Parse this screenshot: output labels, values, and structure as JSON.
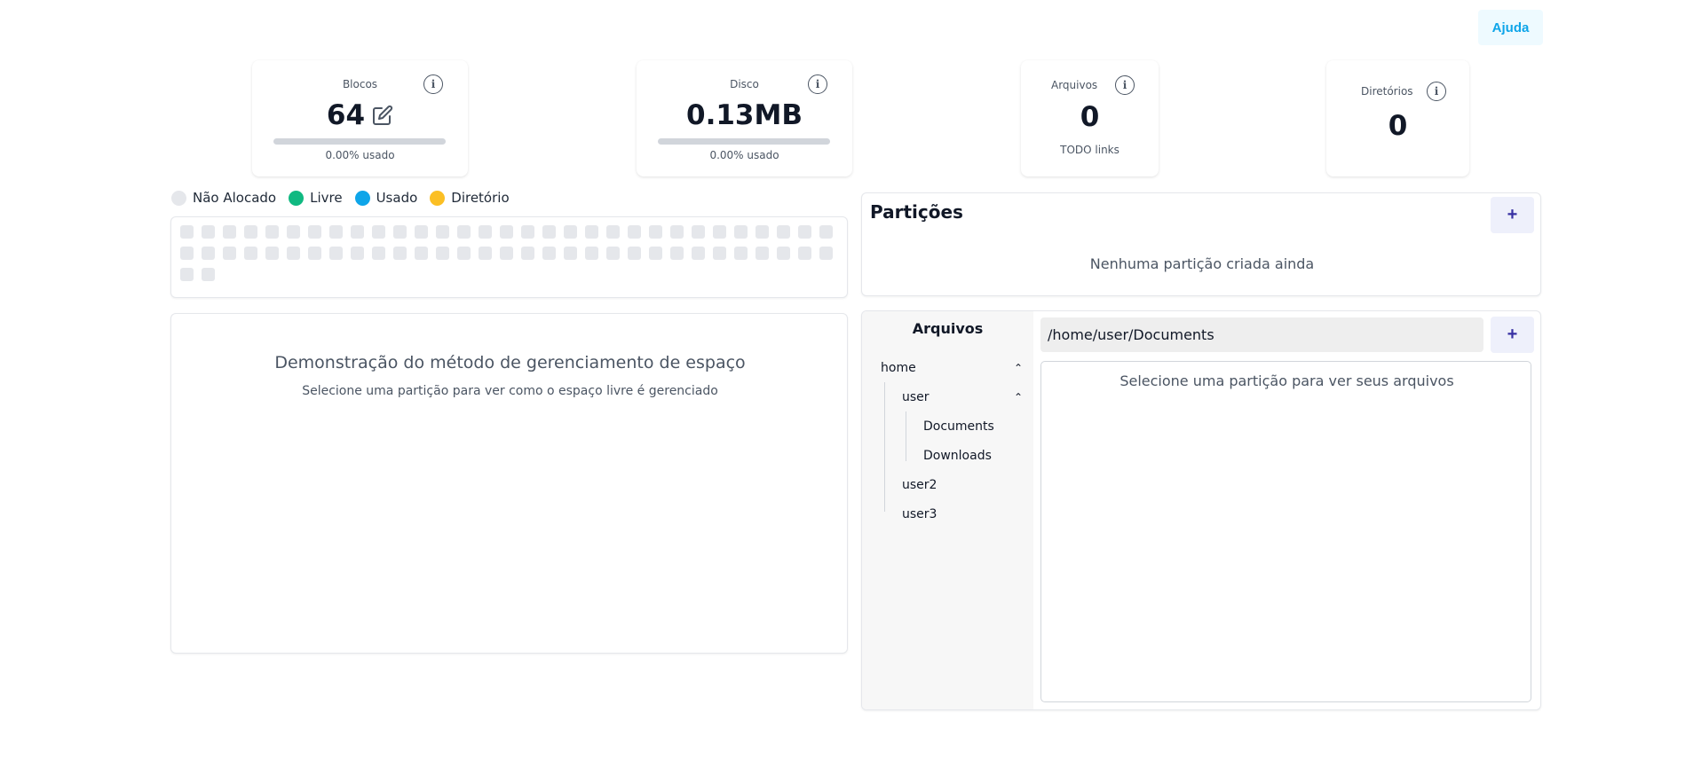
{
  "header": {
    "help_label": "Ajuda"
  },
  "stats": {
    "blocks": {
      "label": "Blocos",
      "value": "64",
      "usage_text": "0.00% usado",
      "usage_fraction": 0
    },
    "disk": {
      "label": "Disco",
      "value": "0.13MB",
      "usage_text": "0.00% usado",
      "usage_fraction": 0
    },
    "files": {
      "label": "Arquivos",
      "value": "0",
      "sub": "TODO links"
    },
    "dirs": {
      "label": "Diretórios",
      "value": "0"
    }
  },
  "legend": [
    {
      "label": "Não Alocado",
      "color": "#e5e7eb"
    },
    {
      "label": "Livre",
      "color": "#10b981"
    },
    {
      "label": "Usado",
      "color": "#0ea5e9"
    },
    {
      "label": "Diretório",
      "color": "#fbbf24"
    }
  ],
  "block_map": {
    "count": 64
  },
  "demo": {
    "title": "Demonstração do método de gerenciamento de espaço",
    "subtitle": "Selecione uma partição para ver como o espaço livre é gerenciado"
  },
  "partitions": {
    "title": "Partições",
    "add_label": "+",
    "empty_text": "Nenhuma partição criada ainda"
  },
  "files_panel": {
    "title": "Arquivos",
    "path_value": "/home/user/Documents",
    "add_label": "+",
    "empty_text": "Selecione uma partição para ver seus arquivos",
    "tree": {
      "home": "home",
      "user": "user",
      "documents": "Documents",
      "downloads": "Downloads",
      "user2": "user2",
      "user3": "user3"
    }
  },
  "icons": {
    "info": "info-icon",
    "edit": "edit-icon",
    "chevron": "chevron-up-icon"
  }
}
